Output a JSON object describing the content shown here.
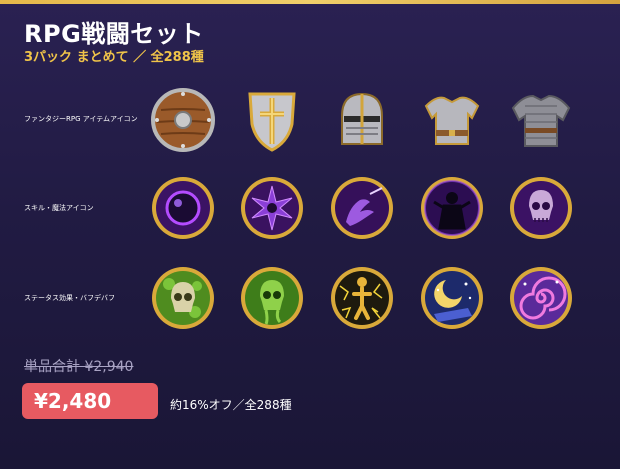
{
  "title": "RPG戦闘セット",
  "subtitle": "3パック まとめて ／ 全288種",
  "rows": [
    {
      "label": "ファンタジーRPG アイテムアイコン",
      "icons": [
        "round-shield-icon",
        "cross-shield-icon",
        "knight-helmet-icon",
        "plate-armor-icon",
        "chainmail-shirt-icon"
      ]
    },
    {
      "label": "スキル・魔法アイコン",
      "icons": [
        "dark-orb-icon",
        "dark-sigil-icon",
        "magic-claw-icon",
        "shadow-figure-icon",
        "skull-curse-icon"
      ]
    },
    {
      "label": "ステータス効果・バフデバフ",
      "icons": [
        "poison-skull-icon",
        "toxic-skull-icon",
        "paralysis-icon",
        "sleep-moon-icon",
        "confusion-swirl-icon"
      ]
    }
  ],
  "pricing": {
    "original": "単品合計 ¥2,940",
    "price": "¥2,480",
    "discount": "約16%オフ／全288種"
  },
  "colors": {
    "accent": "#f0c449",
    "price_bg": "#e75a61",
    "background": "#211b43"
  }
}
